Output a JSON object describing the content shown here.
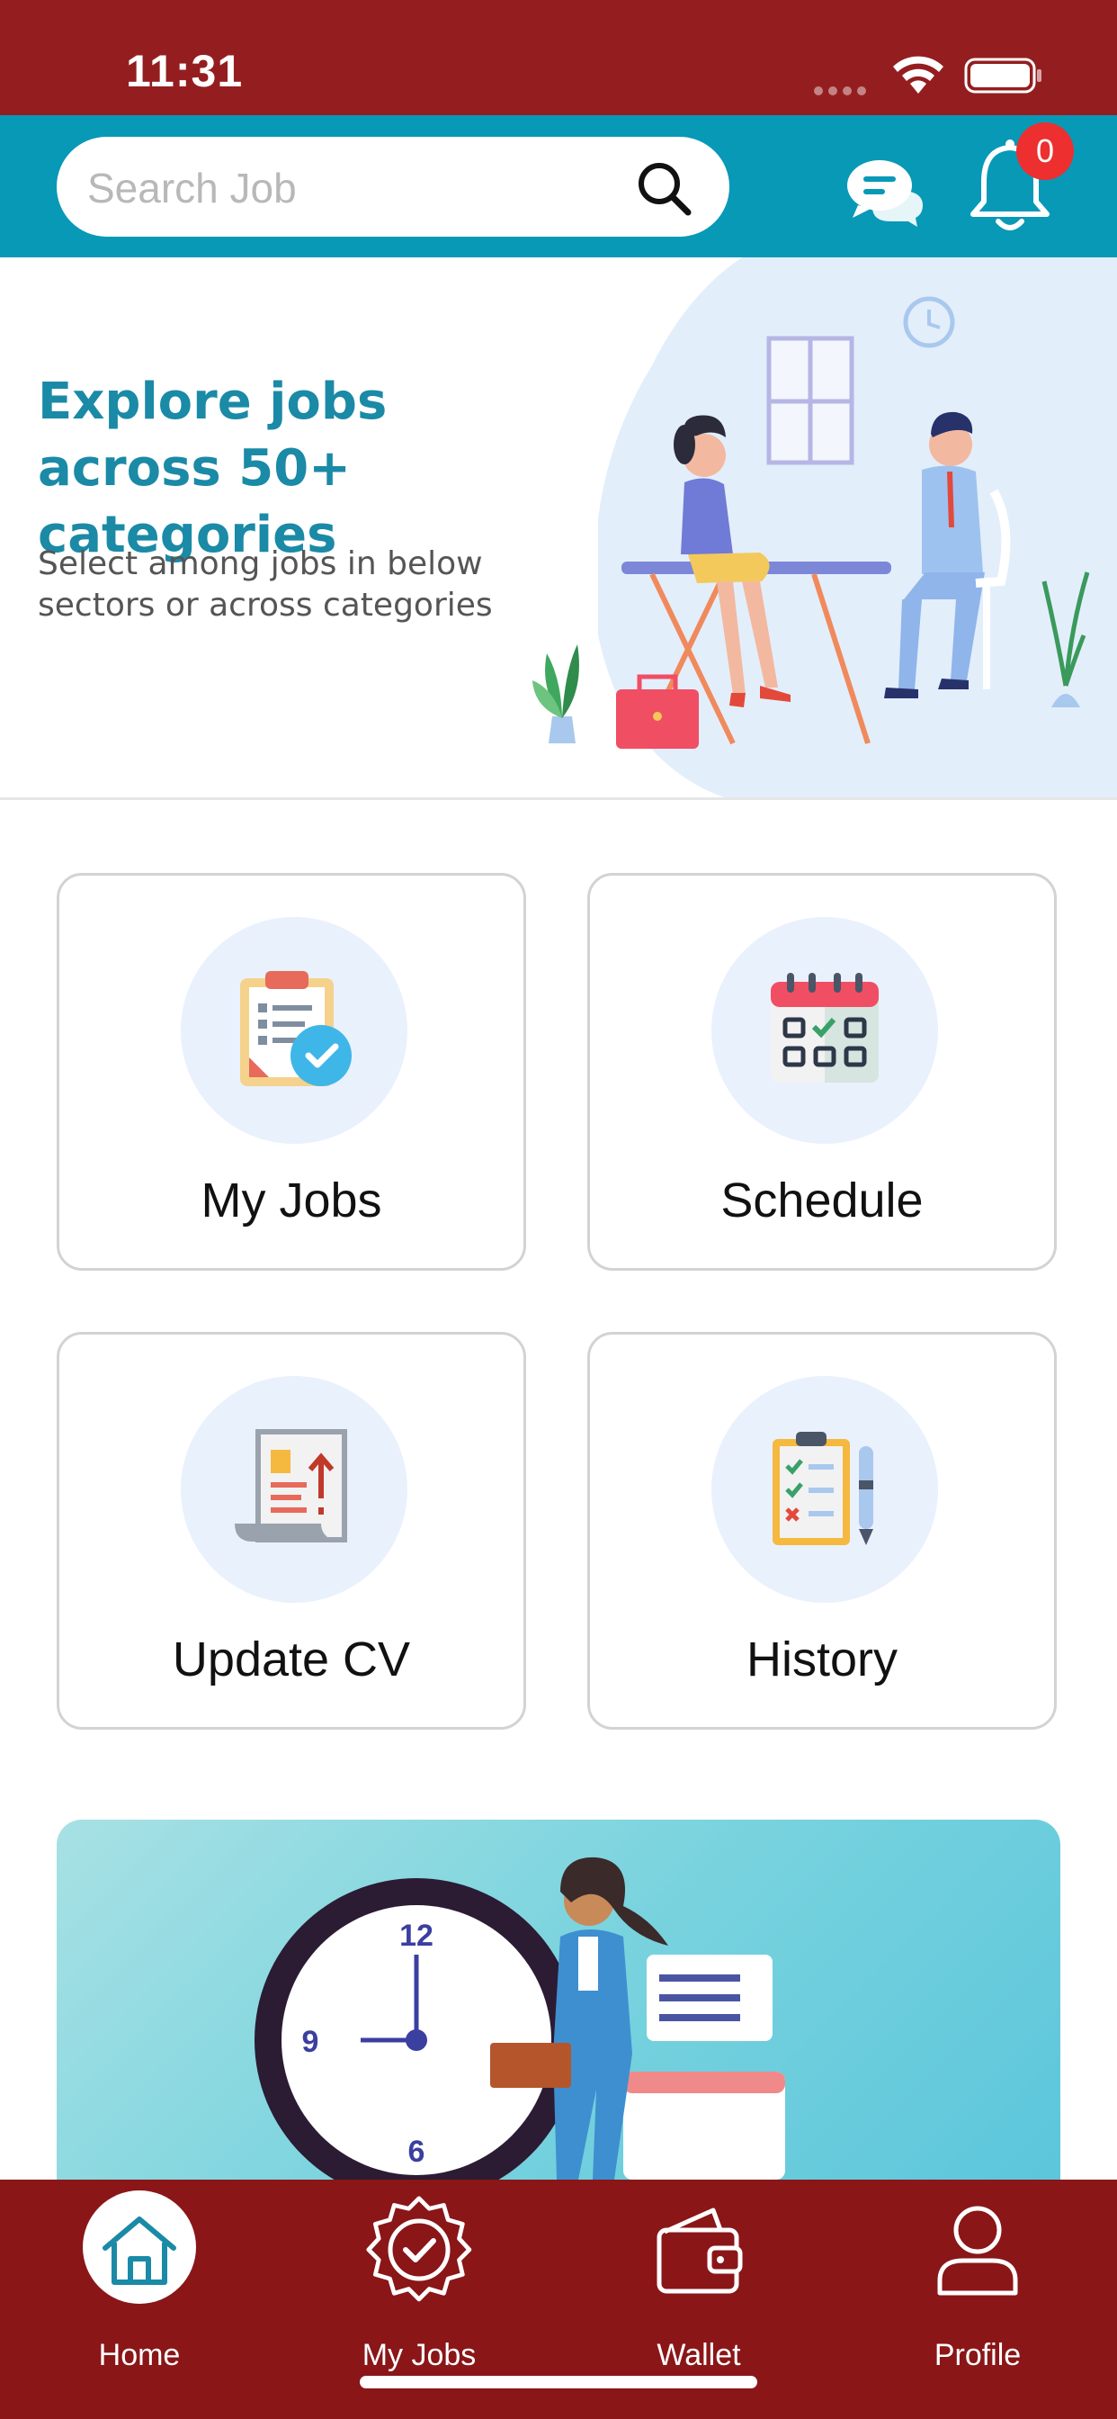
{
  "status_bar": {
    "time": "11:31"
  },
  "header": {
    "search_placeholder": "Search Job",
    "notification_count": "0",
    "colors": {
      "header_bg": "#0899b7",
      "status_bg": "#941e1f",
      "badge": "#ed2f2f"
    }
  },
  "hero": {
    "title": "Explore jobs across 50+ categories",
    "subtitle": "Select among jobs in below sectors or across categories"
  },
  "tiles": [
    {
      "label": "My Jobs",
      "icon": "clipboard-check-icon"
    },
    {
      "label": "Schedule",
      "icon": "calendar-icon"
    },
    {
      "label": "Update CV",
      "icon": "cv-upload-icon"
    },
    {
      "label": "History",
      "icon": "checklist-icon"
    }
  ],
  "bottom_nav": {
    "items": [
      {
        "label": "Home",
        "icon": "home-icon",
        "active": true
      },
      {
        "label": "My Jobs",
        "icon": "badge-check-icon"
      },
      {
        "label": "Wallet",
        "icon": "wallet-icon"
      },
      {
        "label": "Profile",
        "icon": "profile-icon"
      }
    ],
    "bg_color": "#8a1618"
  }
}
